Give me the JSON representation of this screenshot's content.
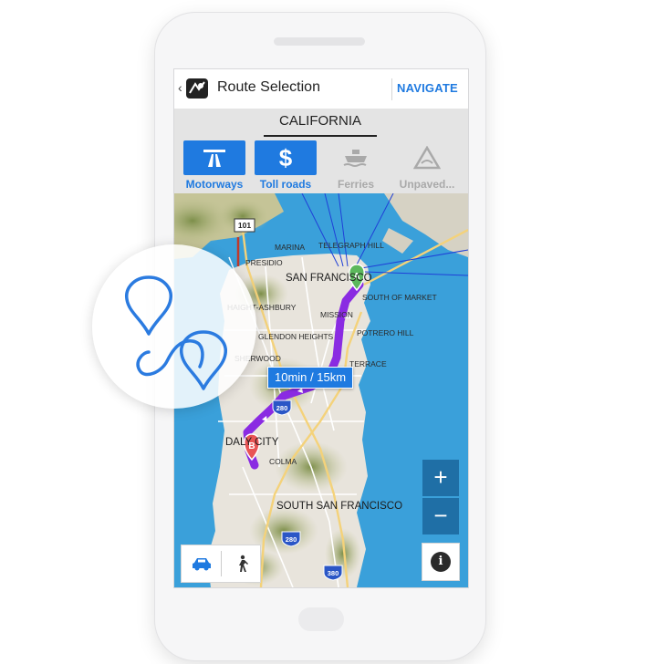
{
  "header": {
    "title": "Route Selection",
    "navigate_label": "NAVIGATE",
    "back_icon": "chevron-left-icon",
    "logo_icon": "map-pin-logo-icon"
  },
  "region": {
    "name": "CALIFORNIA"
  },
  "route_options": [
    {
      "label": "Motorways",
      "icon": "motorway-icon",
      "active": true
    },
    {
      "label": "Toll roads",
      "icon": "dollar-icon",
      "active": true
    },
    {
      "label": "Ferries",
      "icon": "ferry-icon",
      "active": false
    },
    {
      "label": "Unpaved...",
      "icon": "unpaved-road-icon",
      "active": false
    }
  ],
  "map": {
    "labels": {
      "marina": "MARINA",
      "telegraph_hill": "TELEGRAPH HILL",
      "presidio": "PRESIDIO",
      "san_francisco": "SAN FRANCISCO",
      "south_of_market": "SOUTH OF MARKET",
      "haight_ashbury": "HAIGHT-ASHBURY",
      "mission": "MISSION",
      "potrero_hill": "POTRERO HILL",
      "glen_heights": "GLENDON HEIGHTS",
      "sherwood": "SHERWOOD",
      "terrace": "TERRACE",
      "daly_city": "DALY CITY",
      "colma": "COLMA",
      "south_san_francisco": "SOUTH SAN FRANCISCO"
    },
    "shields": [
      "101",
      "280",
      "280",
      "380"
    ],
    "start_marker": "A",
    "end_marker": "B",
    "travel_time": "10min / 15km",
    "zoom_in_label": "+",
    "zoom_out_label": "−",
    "info_label": "i",
    "transport_modes": [
      {
        "icon": "car-icon",
        "active": true
      },
      {
        "icon": "pedestrian-icon",
        "active": false
      }
    ]
  },
  "colors": {
    "accent": "#1f7ae0",
    "route": "#8a2be2",
    "water": "#3aa0da",
    "land": "#e8e4dc",
    "start_pin": "#5cb85c",
    "end_pin": "#e85454"
  }
}
